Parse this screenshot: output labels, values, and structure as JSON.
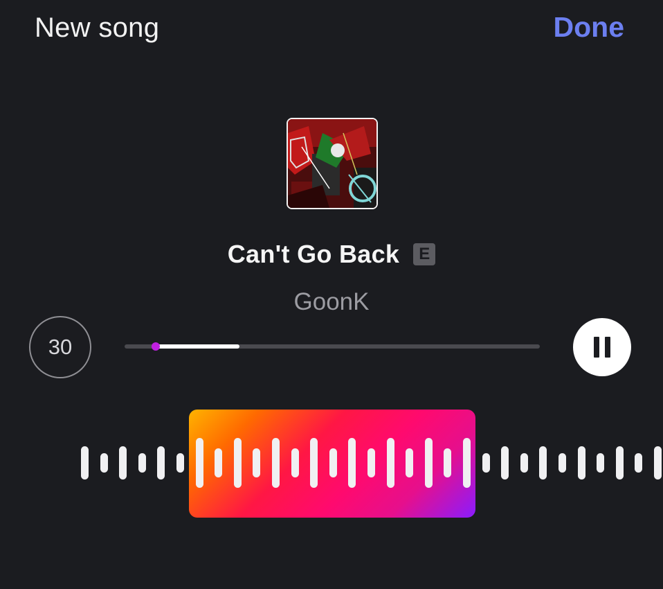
{
  "header": {
    "title": "New song",
    "done_label": "Done"
  },
  "song": {
    "title": "Can't Go Back",
    "explicit_badge": "E",
    "artist": "GoonK"
  },
  "controls": {
    "duration_label": "30",
    "progress_fraction": 0.277,
    "selection_start_fraction": 0.075,
    "play_state": "playing",
    "pause_icon": "pause-icon"
  },
  "colors": {
    "accent": "#6c7ff0",
    "background": "#1b1c20",
    "selection_gradient": [
      "#ffb300",
      "#ff1744",
      "#ff0a6e",
      "#8a1cff"
    ],
    "progress_knob": "#c020e0"
  }
}
